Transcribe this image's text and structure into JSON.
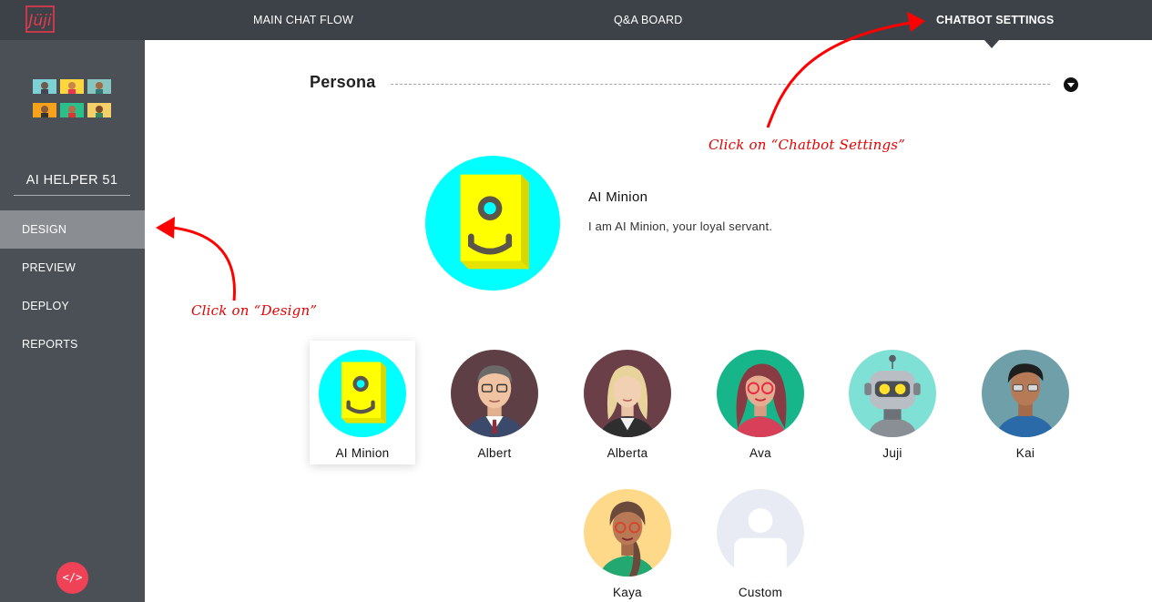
{
  "app": {
    "logo_text": "Juji"
  },
  "top_nav": {
    "items": [
      {
        "label": "MAIN CHAT FLOW",
        "active": false
      },
      {
        "label": "Q&A BOARD",
        "active": false
      },
      {
        "label": "CHATBOT SETTINGS",
        "active": true
      }
    ]
  },
  "sidebar": {
    "bot_name": "AI HELPER 51",
    "items": [
      {
        "label": "DESIGN",
        "active": true
      },
      {
        "label": "PREVIEW",
        "active": false
      },
      {
        "label": "DEPLOY",
        "active": false
      },
      {
        "label": "REPORTS",
        "active": false
      }
    ],
    "code_button_label": "</>"
  },
  "section": {
    "title": "Persona"
  },
  "selected_persona": {
    "name": "AI Minion",
    "description": "I am AI Minion, your loyal servant."
  },
  "personas": [
    {
      "name": "AI Minion",
      "selected": true
    },
    {
      "name": "Albert",
      "selected": false
    },
    {
      "name": "Alberta",
      "selected": false
    },
    {
      "name": "Ava",
      "selected": false
    },
    {
      "name": "Juji",
      "selected": false
    },
    {
      "name": "Kai",
      "selected": false
    },
    {
      "name": "Kaya",
      "selected": false
    },
    {
      "name": "Custom",
      "selected": false
    }
  ],
  "annotations": {
    "chatbot_settings": "Click on “Chatbot Settings”",
    "design": "Click on “Design”"
  },
  "colors": {
    "topbar": "#3d4249",
    "sidebar": "#4b5057",
    "sidebar_active": "#8a8d91",
    "accent_red": "#ef4257",
    "annotation_red": "#e60000",
    "minion_cyan": "#00ffff",
    "minion_yellow": "#ffff00"
  }
}
